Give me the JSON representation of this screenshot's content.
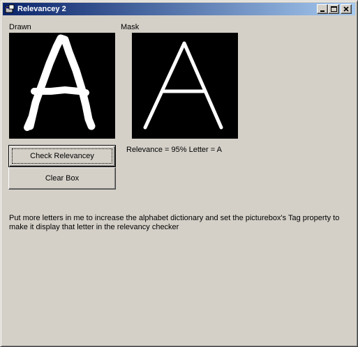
{
  "window": {
    "title": "Relevancey 2",
    "controls": {
      "minimize_icon": "minimize-icon",
      "maximize_icon": "maximize-icon",
      "close_icon": "close-icon"
    }
  },
  "drawn_panel": {
    "label": "Drawn"
  },
  "mask_panel": {
    "label": "Mask"
  },
  "result": {
    "text": "Relevance = 95% Letter = A"
  },
  "buttons": {
    "check_relevancy": "Check Relevancey",
    "clear_box": "Clear Box"
  },
  "note": {
    "text": "Put more letters in me to increase the alphabet dictionary and set the picturebox's Tag property to make it display that letter in the relevancy checker"
  },
  "colors": {
    "title_gradient_start": "#0a246a",
    "title_gradient_end": "#a6caf0",
    "window_face": "#d4d0c8",
    "picture_background": "#000000",
    "stroke": "#ffffff"
  }
}
